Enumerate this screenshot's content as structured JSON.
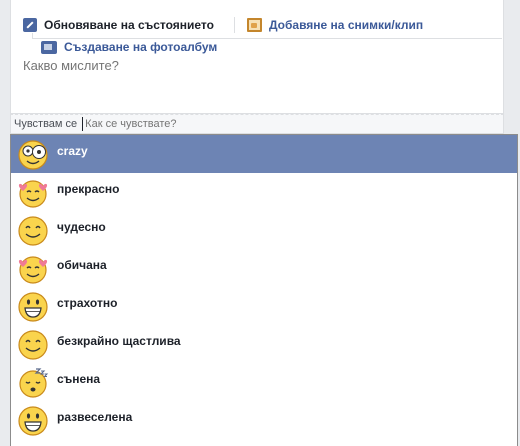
{
  "composer": {
    "tabs": [
      {
        "label": "Обновяване на състоянието",
        "icon": "pencil-icon"
      },
      {
        "label": "Добавяне на снимки/клип",
        "icon": "photo-icon"
      }
    ],
    "album_label": "Създаване на фотоалбум",
    "status_placeholder": "Какво мислите?"
  },
  "feeling": {
    "label": "Чувствам се",
    "placeholder": "Как се чувствате?"
  },
  "options": [
    {
      "label": "crazy",
      "icon": "crazy-face-icon",
      "selected": true
    },
    {
      "label": "прекрасно",
      "icon": "hearts-face-icon",
      "selected": false
    },
    {
      "label": "чудесно",
      "icon": "happy-face-icon",
      "selected": false
    },
    {
      "label": "обичана",
      "icon": "hearts-face-icon",
      "selected": false
    },
    {
      "label": "страхотно",
      "icon": "big-grin-icon",
      "selected": false
    },
    {
      "label": "безкрайно щастлива",
      "icon": "happy-face-icon",
      "selected": false
    },
    {
      "label": "сънена",
      "icon": "sleepy-face-icon",
      "selected": false
    },
    {
      "label": "развеселена",
      "icon": "big-grin-icon",
      "selected": false
    }
  ],
  "colors": {
    "selected_row": "#6d84b4",
    "link": "#3b5998",
    "emoji_fill": "#fad44d",
    "emoji_stroke": "#c98a1b"
  }
}
